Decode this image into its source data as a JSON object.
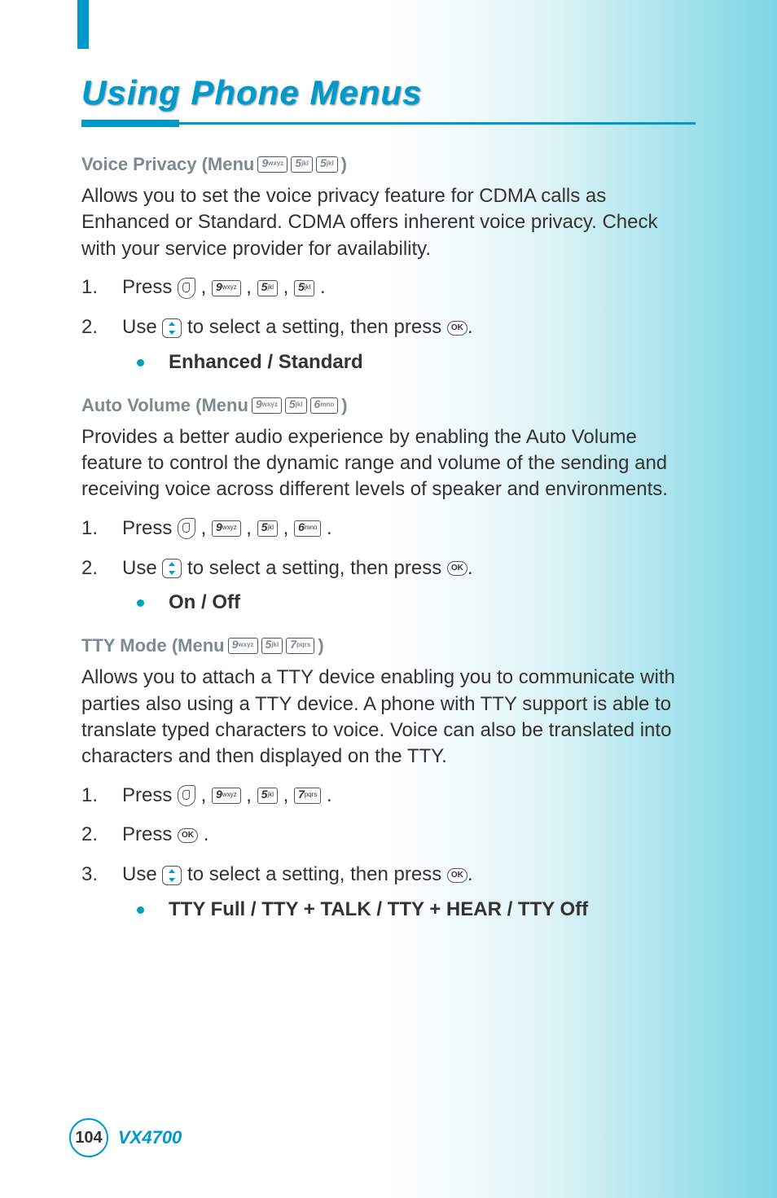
{
  "header": {
    "title": "Using Phone Menus"
  },
  "sections": [
    {
      "id": "voice-privacy",
      "heading_prefix": "Voice Privacy (Menu",
      "heading_keys": [
        "9wxyz",
        "5jkl",
        "5jkl"
      ],
      "heading_suffix": ")",
      "paragraph": "Allows you to set the voice privacy feature for CDMA calls as Enhanced or Standard. CDMA offers inherent voice privacy. Check with your service provider for availability.",
      "steps": [
        {
          "prefix": "Press ",
          "icons": [
            "softkey",
            "9wxyz",
            "5jkl",
            "5jkl"
          ],
          "suffix": "."
        },
        {
          "prefix": "Use ",
          "mid1_icon": "nav",
          "mid1_text": " to select a setting, then press ",
          "mid2_icon": "ok",
          "mid2_text": ".",
          "bullet": "Enhanced / Standard"
        }
      ]
    },
    {
      "id": "auto-volume",
      "heading_prefix": "Auto Volume (Menu",
      "heading_keys": [
        "9wxyz",
        "5jkl",
        "6mno"
      ],
      "heading_suffix": ")",
      "paragraph": "Provides a better audio experience by enabling the Auto Volume feature to control the dynamic range and volume of the sending and receiving voice across different levels of speaker and environments.",
      "steps": [
        {
          "prefix": "Press ",
          "icons": [
            "softkey",
            "9wxyz",
            "5jkl",
            "6mno"
          ],
          "suffix": "."
        },
        {
          "prefix": "Use ",
          "mid1_icon": "nav",
          "mid1_text": " to select a setting, then press ",
          "mid2_icon": "ok",
          "mid2_text": ".",
          "bullet": "On / Off"
        }
      ]
    },
    {
      "id": "tty-mode",
      "heading_prefix": "TTY Mode (Menu",
      "heading_keys": [
        "9wxyz",
        "5jkl",
        "7pqrs"
      ],
      "heading_suffix": ")",
      "paragraph": "Allows you to attach a TTY device enabling you to communicate with parties also using a TTY device. A phone with TTY support is able to translate typed characters to voice. Voice can also be translated into characters and then displayed on the TTY.",
      "steps": [
        {
          "prefix": "Press ",
          "icons": [
            "softkey",
            "9wxyz",
            "5jkl",
            "7pqrs"
          ],
          "suffix": "."
        },
        {
          "prefix": "Press ",
          "mid1_icon": "ok",
          "mid1_text": " ."
        },
        {
          "prefix": "Use ",
          "mid1_icon": "nav",
          "mid1_text": " to select a setting, then press ",
          "mid2_icon": "ok",
          "mid2_text": ".",
          "bullet": "TTY Full / TTY + TALK / TTY + HEAR / TTY Off"
        }
      ]
    }
  ],
  "footer": {
    "page_number": "104",
    "model": "VX4700"
  },
  "keycaps": {
    "9wxyz": {
      "num": "9",
      "let": "wxyz"
    },
    "5jkl": {
      "num": "5",
      "let": "jkl"
    },
    "6mno": {
      "num": "6",
      "let": "mno"
    },
    "7pqrs": {
      "num": "7",
      "let": "pqrs"
    },
    "ok": {
      "label": "OK"
    }
  }
}
